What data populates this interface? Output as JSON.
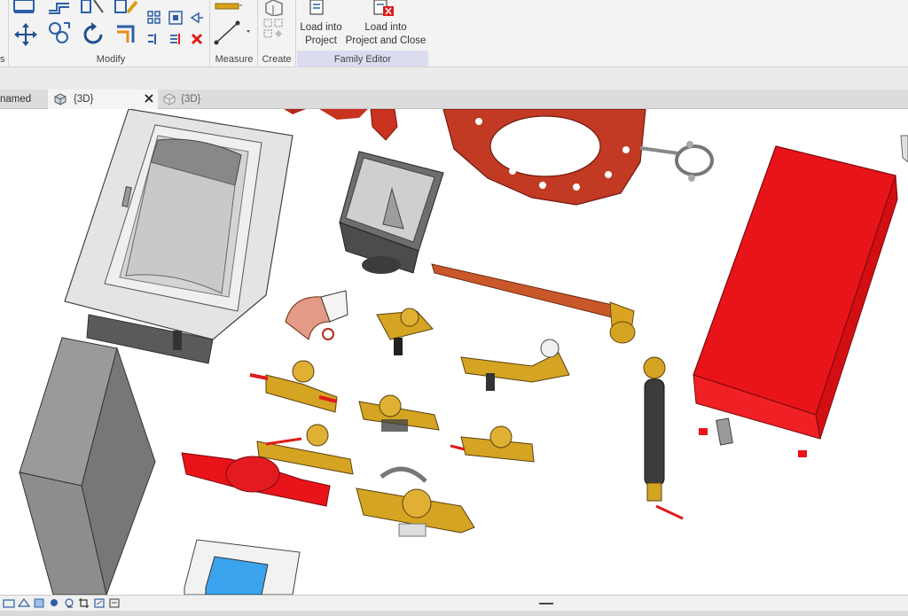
{
  "ribbon": {
    "panels": {
      "modify": "Modify",
      "measure": "Measure",
      "create": "Create",
      "family_editor": "Family Editor"
    },
    "buttons": {
      "load_into_project_line1": "Load into",
      "load_into_project_line2": "Project",
      "load_into_project_close_line1": "Load into",
      "load_into_project_close_line2": "Project and Close"
    },
    "left_fragment": "s"
  },
  "tabs": [
    {
      "label": "named"
    },
    {
      "label": "{3D}"
    },
    {
      "label": "{3D}"
    }
  ],
  "colors": {
    "ribbon_bg": "#f3f3f3",
    "family_editor_highlight": "#dcdcf0",
    "tab_active": "#f4f4f4",
    "fire_red": "#e8141a",
    "flange_red": "#c0321e",
    "brass": "#d4a422",
    "copper": "#c9572a",
    "grey_box": "#8e8e8e",
    "glass_blue": "#3aa3ee"
  }
}
